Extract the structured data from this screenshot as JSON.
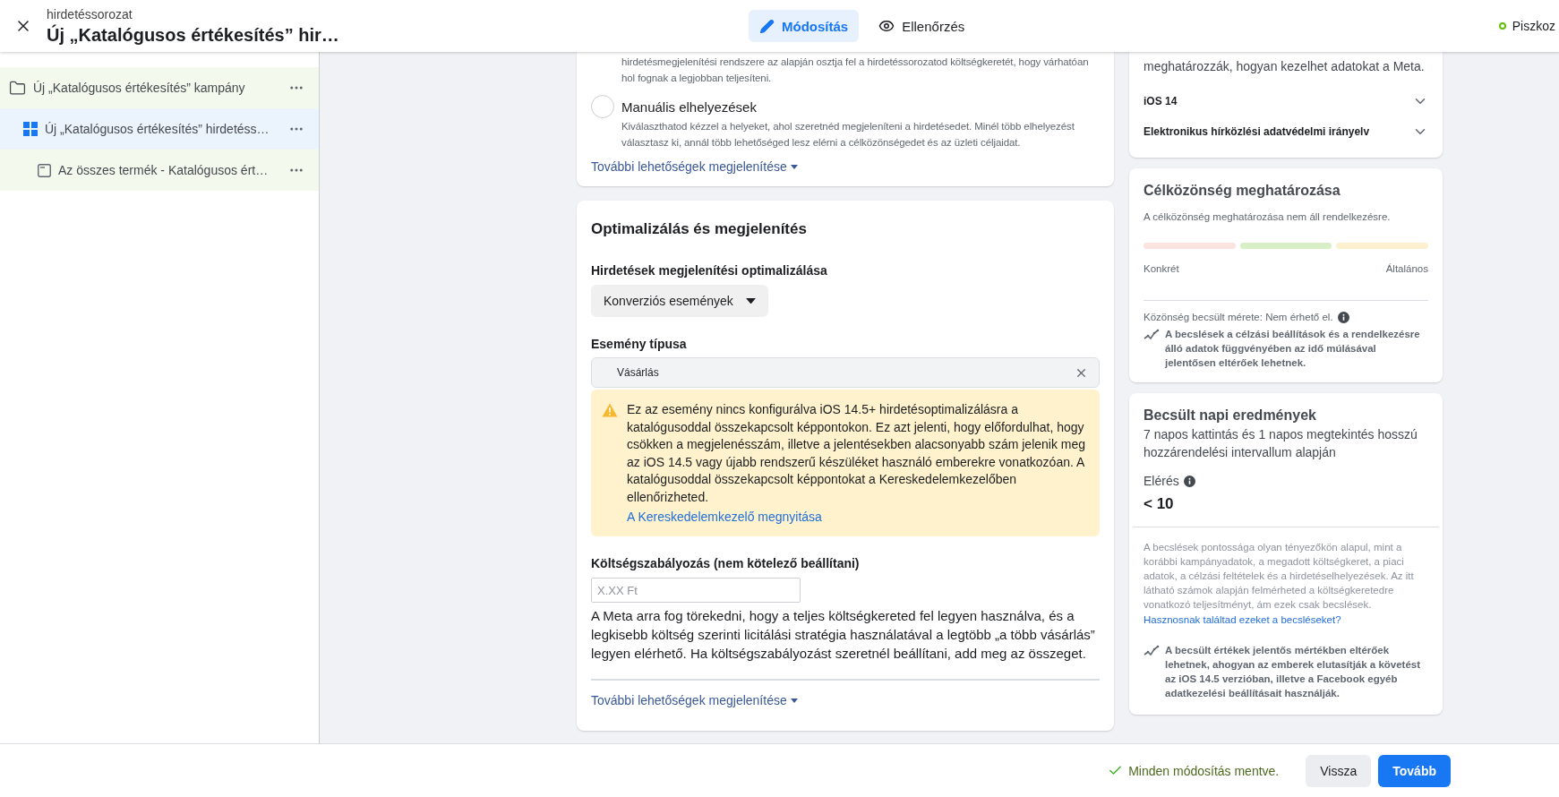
{
  "header": {
    "subtitle": "hirdetéssorozat",
    "title": "Új „Katalógusos értékesítés” hir…",
    "tabs": [
      {
        "label": "Módosítás",
        "kind": "edit",
        "selected": true
      },
      {
        "label": "Ellenőrzés",
        "kind": "review",
        "selected": false
      }
    ],
    "status": "Piszkoz"
  },
  "sidebar": {
    "items": [
      {
        "kind": "campaign",
        "label": "Új „Katalógusos értékesítés” kampány",
        "selected": false,
        "children": [
          {
            "kind": "adset",
            "label": "Új „Katalógusos értékesítés” hirdetéss…",
            "selected": true,
            "children": [
              {
                "kind": "ad",
                "label": "Az összes termék - Katalógusos ért…",
                "selected": false
              }
            ]
          }
        ]
      }
    ]
  },
  "placement_card": {
    "text_above": "hirdetésmegjelenítési rendszere az alapján osztja fel a hirdetéssorozatod költségkeretét, hogy várhatóan hol fognak a legjobban teljesíteni.",
    "options": [
      {
        "label": "Manuális elhelyezések",
        "description": "Kiválaszthatod kézzel a helyeket, ahol szeretnéd megjeleníteni a hirdetésedet. Minél több elhelyezést választasz ki, annál több lehetőséged lesz elérni a célközönségedet és az üzleti céljaidat.",
        "selected": false
      }
    ],
    "more_link": "További lehetőségek megjelenítése"
  },
  "optimization_card": {
    "title": "Optimalizálás és megjelenítés",
    "delivery_label": "Hirdetések megjelenítési optimalizálása",
    "delivery_value": "Konverziós események",
    "event_label": "Esemény típusa",
    "event_value": "Vásárlás",
    "warning": {
      "text": "Ez az esemény nincs konfigurálva iOS 14.5+ hirdetésoptimalizálásra a katalógusoddal összekapcsolt képpontokon. Ez azt jelenti, hogy előfordulhat, hogy csökken a megjelenésszám, illetve a jelentésekben alacsonyabb szám jelenik meg az iOS 14.5 vagy újabb rendszerű készüléket használó emberekre vonatkozóan. A katalógusoddal összekapcsolt képpontokat a Kereskedelemkezelőben ellenőrizheted.",
      "link": "A Kereskedelemkezelő megnyitása"
    },
    "cost_label": "Költségszabályozás (nem kötelező beállítani)",
    "cost_placeholder": "X.XX Ft",
    "cost_help": "A Meta arra fog törekedni, hogy a teljes költségkereted fel legyen használva, és a legkisebb költség szerinti licitálási stratégia használatával a legtöbb „a több vásárlás” legyen elérhető. Ha költségszabályozást szeretnél beállítani, add meg az összeget.",
    "more_link": "További lehetőségek megjelenítése"
  },
  "privacy_card": {
    "text": "meghatározzák, hogyan kezelhet adatokat a Meta.",
    "sections": [
      {
        "label": "iOS 14",
        "expanded": false
      },
      {
        "label": "Elektronikus hírközlési adatvédelmi irányelv",
        "expanded": false
      }
    ]
  },
  "audience_card": {
    "title": "Célközönség meghatározása",
    "text": "A célközönség meghatározása nem áll rendelkezésre.",
    "scale_segments": [
      {
        "color": "#fbe4e0"
      },
      {
        "color": "#d8efc6"
      },
      {
        "color": "#fdf0cf"
      }
    ],
    "scale_min": "Konkrét",
    "scale_max": "Általános",
    "size_label": "Közönség becsült mérete: Nem érhető el.",
    "note": "A becslések a célzási beállítások és a rendelkezésre álló adatok függvényében az idő múlásával jelentősen eltérőek lehetnek."
  },
  "results_card": {
    "title": "Becsült napi eredmények",
    "subtitle": "7 napos kattintás és 1 napos megtekintés hosszú hozzárendelési intervallum alapján",
    "metric_label": "Elérés",
    "metric_value": "< 10",
    "disclaimer": "A becslések pontossága olyan tényezőkön alapul, mint a korábbi kampányadatok, a megadott költségkeret, a piaci adatok, a célzási feltételek és a hirdetéselhelyezések. Az itt látható számok alapján felmérheted a költségkeretedre vonatkozó teljesítményt, ám ezek csak becslések.",
    "feedback_link": "Hasznosnak találtad ezeket a becsléseket?",
    "note": "A becsült értékek jelentős mértékben eltérőek lehetnek, ahogyan az emberek elutasítják a követést az iOS 14.5 verzióban, illetve a Facebook egyéb adatkezelési beállításait használják."
  },
  "footer": {
    "saved": "Minden módosítás mentve.",
    "buttons": [
      {
        "label": "Vissza",
        "kind": "secondary"
      },
      {
        "label": "Tovább",
        "kind": "primary"
      }
    ]
  }
}
